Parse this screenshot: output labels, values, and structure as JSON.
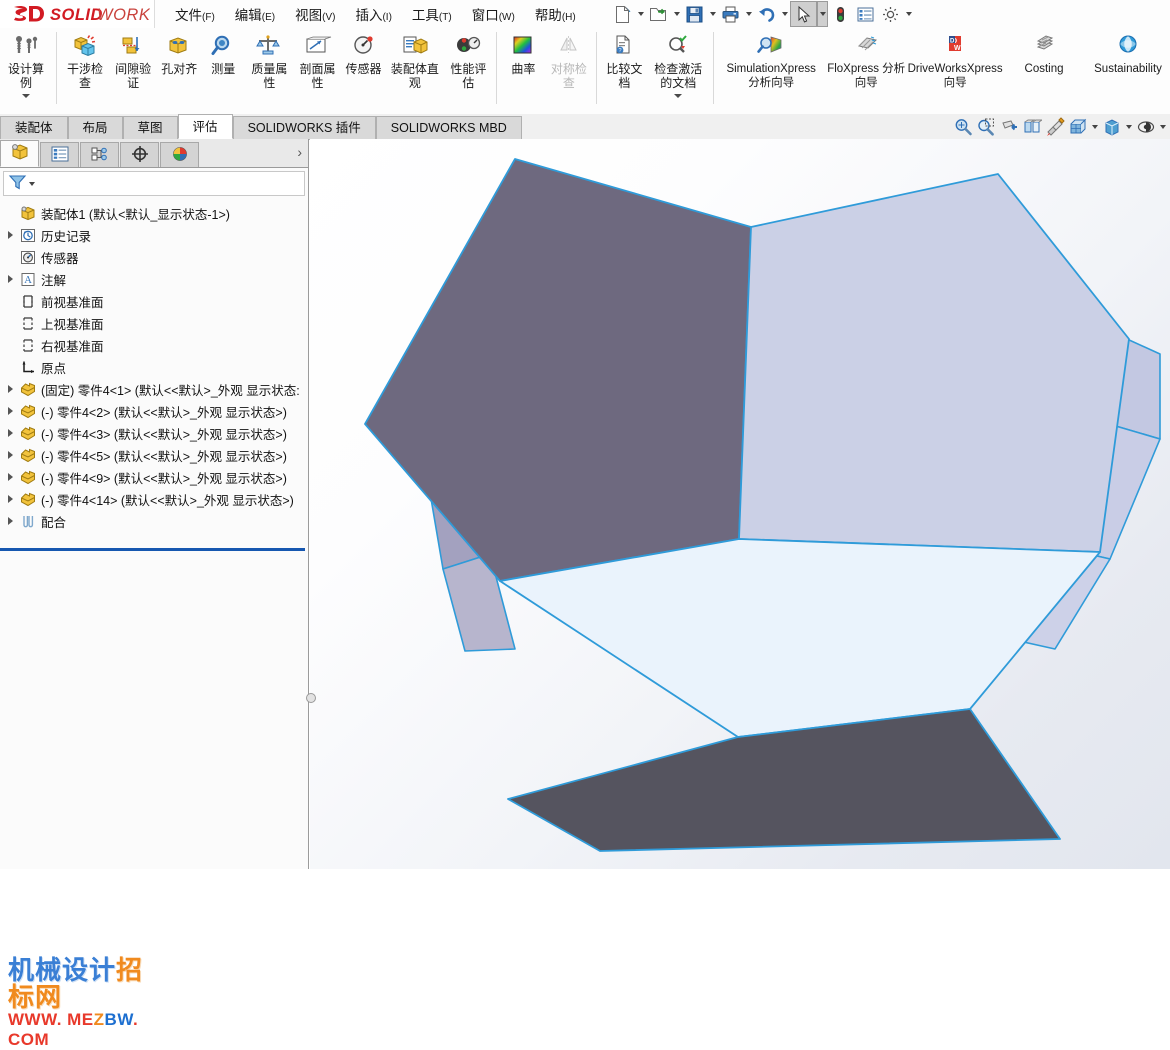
{
  "app": {
    "brand": "SOLIDWORKS",
    "brand_prefix": "SOLID",
    "brand_suffix": "WORKS",
    "brand_color": "#d21b23"
  },
  "menubar": {
    "items": [
      {
        "label": "文件",
        "mnemonic": "(F)",
        "name": "menu-file"
      },
      {
        "label": "编辑",
        "mnemonic": "(E)",
        "name": "menu-edit"
      },
      {
        "label": "视图",
        "mnemonic": "(V)",
        "name": "menu-view"
      },
      {
        "label": "插入",
        "mnemonic": "(I)",
        "name": "menu-insert"
      },
      {
        "label": "工具",
        "mnemonic": "(T)",
        "name": "menu-tools"
      },
      {
        "label": "窗口",
        "mnemonic": "(W)",
        "name": "menu-window"
      },
      {
        "label": "帮助",
        "mnemonic": "(H)",
        "name": "menu-help"
      }
    ],
    "pin_icon": "pushpin-icon",
    "quick_access": [
      {
        "name": "new-document-button",
        "icon": "new-file-icon",
        "has_caret": true
      },
      {
        "name": "open-document-button",
        "icon": "open-folder-icon",
        "has_caret": true
      },
      {
        "name": "save-button",
        "icon": "floppy-disk-icon",
        "has_caret": true
      },
      {
        "name": "print-button",
        "icon": "printer-icon",
        "has_caret": true
      },
      {
        "name": "undo-button",
        "icon": "undo-arrow-icon",
        "has_caret": true
      },
      {
        "name": "select-button",
        "icon": "cursor-arrow-icon",
        "has_caret": true,
        "selected": true
      },
      {
        "name": "rebuild-button",
        "icon": "traffic-light-icon",
        "has_caret": false
      },
      {
        "name": "options-list-button",
        "icon": "list-panel-icon",
        "has_caret": false
      },
      {
        "name": "options-button",
        "icon": "gear-icon",
        "has_caret": true
      }
    ]
  },
  "ribbon": {
    "groups": [
      {
        "name": "design-study-group",
        "buttons": [
          {
            "label": "设计算例",
            "icon": "design-study-icon",
            "name": "ribbon-design-study",
            "caret": true,
            "wide": false,
            "first": true,
            "disabled": false
          }
        ]
      },
      {
        "name": "evaluate-group",
        "buttons": [
          {
            "label": "干涉检查",
            "icon": "interference-check-icon",
            "name": "ribbon-interference-check",
            "caret": false,
            "wide": false,
            "disabled": false
          },
          {
            "label": "间隙验证",
            "icon": "clearance-verification-icon",
            "name": "ribbon-clearance-verification",
            "caret": false,
            "wide": false,
            "disabled": false
          },
          {
            "label": "孔对齐",
            "icon": "hole-alignment-icon",
            "name": "ribbon-hole-alignment",
            "caret": false,
            "wide": false,
            "disabled": false
          },
          {
            "label": "测量",
            "icon": "measure-icon",
            "name": "ribbon-measure",
            "caret": false,
            "wide": false,
            "disabled": false
          },
          {
            "label": "质量属性",
            "icon": "mass-properties-icon",
            "name": "ribbon-mass-properties",
            "caret": false,
            "wide": false,
            "disabled": false
          },
          {
            "label": "剖面属性",
            "icon": "section-properties-icon",
            "name": "ribbon-section-properties",
            "caret": false,
            "wide": false,
            "disabled": false
          },
          {
            "label": "传感器",
            "icon": "sensor-icon",
            "name": "ribbon-sensor",
            "caret": false,
            "wide": false,
            "disabled": false
          },
          {
            "label": "装配体直观",
            "icon": "assembly-visualization-icon",
            "name": "ribbon-assembly-visualization",
            "caret": false,
            "wide": false,
            "disabled": false
          },
          {
            "label": "性能评估",
            "icon": "performance-evaluation-icon",
            "name": "ribbon-performance-evaluation",
            "caret": false,
            "wide": false,
            "disabled": false
          }
        ]
      },
      {
        "name": "curvature-group",
        "buttons": [
          {
            "label": "曲率",
            "icon": "curvature-icon",
            "name": "ribbon-curvature",
            "caret": false,
            "wide": false,
            "disabled": false
          },
          {
            "label": "对称检查",
            "icon": "symmetry-check-icon",
            "name": "ribbon-symmetry-check",
            "caret": false,
            "wide": false,
            "disabled": true
          }
        ]
      },
      {
        "name": "documents-group",
        "buttons": [
          {
            "label": "比较文档",
            "icon": "compare-documents-icon",
            "name": "ribbon-compare-documents",
            "caret": false,
            "wide": false,
            "disabled": false
          },
          {
            "label": "检查激活的文档",
            "icon": "check-active-document-icon",
            "name": "ribbon-check-active-documents",
            "caret": true,
            "wide": false,
            "disabled": false
          }
        ]
      },
      {
        "name": "xpress-group",
        "buttons": [
          {
            "label": "SimulationXpress 分析向导",
            "icon": "simulationxpress-icon",
            "name": "ribbon-simulationxpress",
            "caret": false,
            "wide": true,
            "disabled": false
          },
          {
            "label": "FloXpress 分析向导",
            "icon": "floxpress-icon",
            "name": "ribbon-floxpress",
            "caret": false,
            "wide": true,
            "disabled": false
          },
          {
            "label": "DriveWorksXpress 向导",
            "icon": "driveworksxpress-icon",
            "name": "ribbon-driveworksxpress",
            "caret": false,
            "wide": true,
            "disabled": false
          },
          {
            "label": "Costing",
            "icon": "costing-icon",
            "name": "ribbon-costing",
            "caret": false,
            "wide": true,
            "disabled": false
          },
          {
            "label": "Sustainability",
            "icon": "sustainability-icon",
            "name": "ribbon-sustainability",
            "caret": false,
            "wide": true,
            "disabled": false
          }
        ]
      }
    ]
  },
  "tabs": {
    "items": [
      {
        "label": "装配体",
        "name": "tab-assembly",
        "active": false
      },
      {
        "label": "布局",
        "name": "tab-layout",
        "active": false
      },
      {
        "label": "草图",
        "name": "tab-sketch",
        "active": false
      },
      {
        "label": "评估",
        "name": "tab-evaluate",
        "active": true
      },
      {
        "label": "SOLIDWORKS 插件",
        "name": "tab-solidworks-addins",
        "active": false
      },
      {
        "label": "SOLIDWORKS MBD",
        "name": "tab-solidworks-mbd",
        "active": false
      }
    ],
    "view_tools": [
      {
        "name": "zoom-to-fit-button",
        "icon": "zoom-to-fit-icon",
        "caret": false
      },
      {
        "name": "zoom-to-area-button",
        "icon": "zoom-to-area-icon",
        "caret": false
      },
      {
        "name": "section-view-button",
        "icon": "section-view-icon",
        "caret": false
      },
      {
        "name": "view-orientation-button",
        "icon": "view-orientation-icon",
        "caret": false
      },
      {
        "name": "appearance-button",
        "icon": "appearance-paint-icon",
        "caret": false
      },
      {
        "name": "display-style-button",
        "icon": "display-style-icon",
        "caret": true
      },
      {
        "name": "hide-show-items-button",
        "icon": "hide-show-cube-icon",
        "caret": true
      },
      {
        "name": "view-settings-button",
        "icon": "view-settings-eye-icon",
        "caret": true
      }
    ]
  },
  "feature_manager": {
    "tabs": [
      {
        "name": "tab-feature-manager-design-tree",
        "icon": "assembly-tree-icon",
        "active": true
      },
      {
        "name": "tab-property-manager",
        "icon": "property-manager-icon",
        "active": false
      },
      {
        "name": "tab-configuration-manager",
        "icon": "configuration-manager-icon",
        "active": false
      },
      {
        "name": "tab-dimxpert-manager",
        "icon": "dimxpert-icon",
        "active": false
      },
      {
        "name": "tab-display-manager",
        "icon": "display-manager-sphere-icon",
        "active": false
      }
    ],
    "expand_chevron": "chevron-right-icon",
    "filter": {
      "icon": "filter-funnel-icon",
      "placeholder": "",
      "value": ""
    },
    "tree": [
      {
        "label": "装配体1  (默认<默认_显示状态-1>)",
        "icon": "assembly-root-icon",
        "indent": 0,
        "expandable": false,
        "name": "tree-item-assembly-root"
      },
      {
        "label": "历史记录",
        "icon": "history-clock-icon",
        "indent": 1,
        "expandable": true,
        "name": "tree-item-history"
      },
      {
        "label": "传感器",
        "icon": "sensor-gauge-icon",
        "indent": 1,
        "expandable": false,
        "name": "tree-item-sensors"
      },
      {
        "label": "注解",
        "icon": "annotations-a-icon",
        "indent": 1,
        "expandable": true,
        "name": "tree-item-annotations"
      },
      {
        "label": "前视基准面",
        "icon": "plane-icon",
        "indent": 1,
        "expandable": false,
        "name": "tree-item-front-plane"
      },
      {
        "label": "上视基准面",
        "icon": "plane-icon",
        "indent": 1,
        "expandable": false,
        "name": "tree-item-top-plane"
      },
      {
        "label": "右视基准面",
        "icon": "plane-icon",
        "indent": 1,
        "expandable": false,
        "name": "tree-item-right-plane"
      },
      {
        "label": "原点",
        "icon": "origin-axes-icon",
        "indent": 1,
        "expandable": false,
        "name": "tree-item-origin"
      },
      {
        "label": "(固定) 零件4<1>  (默认<<默认>_外观 显示状态:",
        "icon": "part-component-icon",
        "indent": 1,
        "expandable": true,
        "name": "tree-item-part4-1"
      },
      {
        "label": "(-) 零件4<2>  (默认<<默认>_外观 显示状态>)",
        "icon": "part-component-icon",
        "indent": 1,
        "expandable": true,
        "name": "tree-item-part4-2"
      },
      {
        "label": "(-) 零件4<3>  (默认<<默认>_外观 显示状态>)",
        "icon": "part-component-icon",
        "indent": 1,
        "expandable": true,
        "name": "tree-item-part4-3"
      },
      {
        "label": "(-) 零件4<5>  (默认<<默认>_外观 显示状态>)",
        "icon": "part-component-icon",
        "indent": 1,
        "expandable": true,
        "name": "tree-item-part4-5"
      },
      {
        "label": "(-) 零件4<9>  (默认<<默认>_外观 显示状态>)",
        "icon": "part-component-icon",
        "indent": 1,
        "expandable": true,
        "name": "tree-item-part4-9"
      },
      {
        "label": "(-) 零件4<14>  (默认<<默认>_外观 显示状态>)",
        "icon": "part-component-icon",
        "indent": 1,
        "expandable": true,
        "name": "tree-item-part4-14"
      },
      {
        "label": "配合",
        "icon": "mates-paperclip-icon",
        "indent": 1,
        "expandable": true,
        "name": "tree-item-mates"
      }
    ]
  },
  "graphics": {
    "model": "dodecahedron-assembly",
    "background_gradient": [
      "#ffffff",
      "#e2e6ee"
    ],
    "edge_color": "#2f9bd9",
    "faces": [
      {
        "name": "face-upper-left-dark",
        "color": "#6e697f"
      },
      {
        "name": "face-upper-right-light",
        "color": "#cbd0e6"
      },
      {
        "name": "face-center-white",
        "color": "#eaf3fc"
      },
      {
        "name": "face-bottom-dark",
        "color": "#55545f"
      },
      {
        "name": "face-left-side",
        "color": "#a8a7c2"
      },
      {
        "name": "face-left-lower-side",
        "color": "#9e9dbb"
      },
      {
        "name": "face-right-side",
        "color": "#c3c8e2"
      },
      {
        "name": "face-right-lower-side",
        "color": "#c9cde6"
      }
    ]
  },
  "watermark": {
    "line1_blue": "机械设计",
    "line1_orange": "招标网",
    "line2": "WWW. MEZBW. COM"
  }
}
